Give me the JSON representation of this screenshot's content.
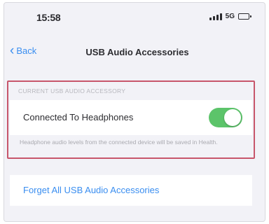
{
  "status_bar": {
    "time": "15:58",
    "network": "5G"
  },
  "nav": {
    "back_label": "Back",
    "title": "USB Audio Accessories"
  },
  "current_accessory": {
    "section_header": "CURRENT USB AUDIO ACCESSORY",
    "toggle_label": "Connected To Headphones",
    "toggle_on": true,
    "footer": "Headphone audio levels from the connected device will be saved in Health."
  },
  "forget": {
    "label": "Forget All USB Audio Accessories"
  },
  "colors": {
    "accent": "#3a8ef0",
    "toggle_on": "#5cc46a",
    "highlight": "#c7566b",
    "background": "#f2f2f7"
  }
}
